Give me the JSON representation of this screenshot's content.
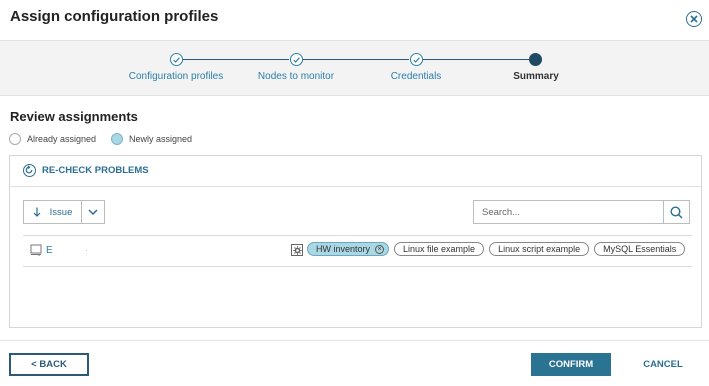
{
  "dialog": {
    "title": "Assign configuration profiles"
  },
  "wizard": {
    "steps": [
      {
        "label": "Configuration profiles",
        "state": "done"
      },
      {
        "label": "Nodes to monitor",
        "state": "done"
      },
      {
        "label": "Credentials",
        "state": "done"
      },
      {
        "label": "Summary",
        "state": "active"
      }
    ]
  },
  "review": {
    "title": "Review assignments",
    "legend": {
      "already": "Already assigned",
      "newly": "Newly assigned"
    }
  },
  "toolbar": {
    "recheck_label": "RE-CHECK PROBLEMS",
    "sort_label": "Issue",
    "search_placeholder": "Search..."
  },
  "rows": [
    {
      "node_name": "E",
      "node_ip": "·",
      "profiles": [
        {
          "label": "HW inventory",
          "state": "newly-assigned"
        },
        {
          "label": "Linux file example",
          "state": "available"
        },
        {
          "label": "Linux script example",
          "state": "available"
        },
        {
          "label": "MySQL Essentials",
          "state": "available"
        }
      ]
    }
  ],
  "footer": {
    "back_label": "< BACK",
    "confirm_label": "CONFIRM",
    "cancel_label": "CANCEL"
  },
  "colors": {
    "accent": "#2b7393",
    "link": "#2b7fa8",
    "newly_assigned": "#a9d7e3",
    "step_active": "#1f4a66"
  }
}
